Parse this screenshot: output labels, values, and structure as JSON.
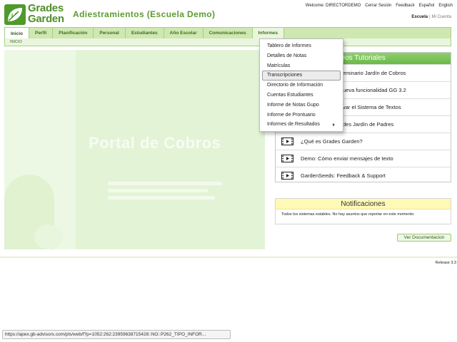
{
  "logo": {
    "line1": "Grades",
    "line2": "Garden"
  },
  "app_title": "Adiestramientos (Escuela Demo)",
  "top_links": {
    "welcome": "Welcome: DIRECTORDEMO",
    "logout": "Cerrar Sesión",
    "feedback": "Feedback",
    "spanish": "Español",
    "english": "English"
  },
  "account_links": {
    "school": "Escuela",
    "separator": "|",
    "my_account": "Mi Cuenta"
  },
  "nav": {
    "tabs": [
      {
        "label": "Inicio"
      },
      {
        "label": "Perfil"
      },
      {
        "label": "Planificación"
      },
      {
        "label": "Personal"
      },
      {
        "label": "Estudiantes"
      },
      {
        "label": "Año Escolar"
      },
      {
        "label": "Comunicaciones"
      },
      {
        "label": "Informes"
      }
    ],
    "active_tab": "Inicio",
    "open_tab": "Informes"
  },
  "breadcrumb": "INICIO",
  "banner": {
    "title": "Portal de Cobros"
  },
  "dropdown": {
    "items": [
      {
        "label": "Tablero de Informes"
      },
      {
        "label": "Detalles de Notas"
      },
      {
        "label": "Matrículas"
      },
      {
        "label": "Transcripciones"
      },
      {
        "label": "Directorio de Información"
      },
      {
        "label": "Cuentas Estudiantes"
      },
      {
        "label": "Informe de Notas Gupo"
      },
      {
        "label": "Informe de Prontuario"
      },
      {
        "label": "Informes de Resultados"
      }
    ],
    "hovered": "Transcripciones"
  },
  "videos": {
    "title": "Videos Tutoriales",
    "title_visible": "deos Tutoriales",
    "items": [
      {
        "label": "eminario Jardín de Cobros"
      },
      {
        "label": "ueva funcionalidad GG 3.2"
      },
      {
        "label": "var el Sistema de Textos"
      },
      {
        "label": "des Jardín de Padres"
      },
      {
        "label": "¿Qué es Grades Garden?"
      },
      {
        "label": "Demo: Cómo enviar mensajes de texto"
      },
      {
        "label": "GardenSeeds: Feedback & Support"
      }
    ]
  },
  "notifications": {
    "title": "Notificaciones",
    "message": "Todos los sistemas estables. No hay asuntos que reportar en este momento."
  },
  "documentation_button": "Ver Documentacion",
  "release": "Release 3.3",
  "status_url": "https://apex.gb-advisors.com/pls/web/f?p=1052:262:23959638715428::NO::P262_TIPO_INFOR..."
}
